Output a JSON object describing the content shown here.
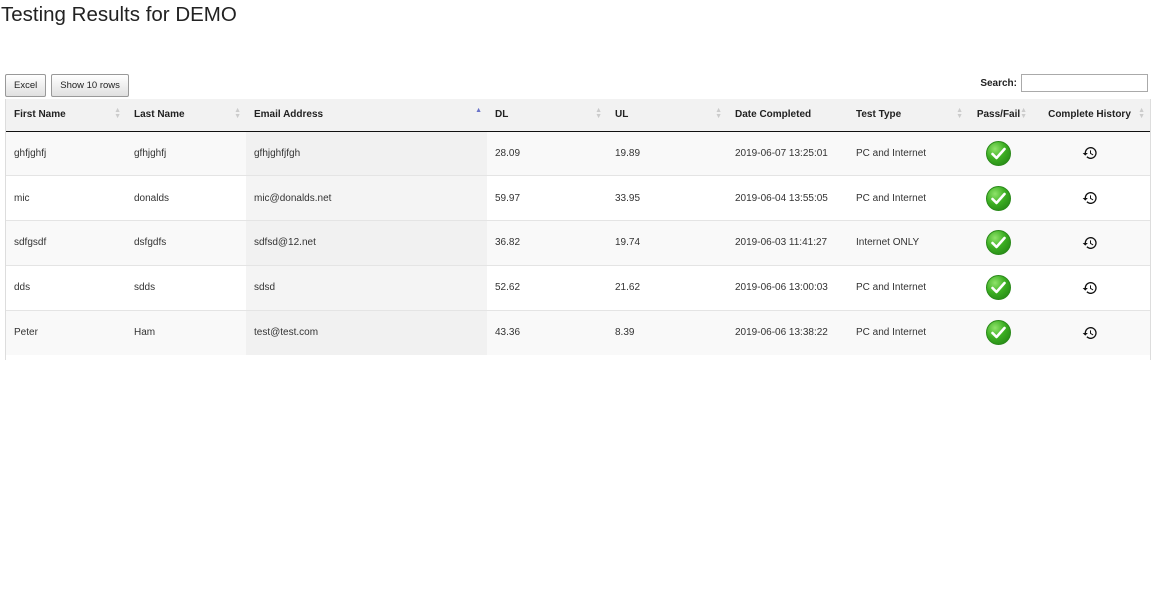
{
  "page": {
    "title": "Testing Results for DEMO"
  },
  "toolbar": {
    "excel_label": "Excel",
    "rows_label": "Show 10 rows"
  },
  "search": {
    "label": "Search:",
    "value": "",
    "placeholder": ""
  },
  "table": {
    "columns": [
      {
        "label": "First Name",
        "sorted": false
      },
      {
        "label": "Last Name",
        "sorted": false
      },
      {
        "label": "Email Address",
        "sorted": "asc"
      },
      {
        "label": "DL",
        "sorted": false
      },
      {
        "label": "UL",
        "sorted": false
      },
      {
        "label": "Date Completed",
        "sorted": false
      },
      {
        "label": "Test Type",
        "sorted": false
      },
      {
        "label": "Pass/Fail",
        "sorted": false
      },
      {
        "label": "Complete History",
        "sorted": false
      }
    ],
    "rows": [
      {
        "first": "ghfjghfj",
        "last": "gfhjghfj",
        "email": "gfhjghfjfgh",
        "dl": "28.09",
        "ul": "19.89",
        "date": "2019-06-07 13:25:01",
        "type": "PC and Internet",
        "status": "pass-icon",
        "history": "history-icon"
      },
      {
        "first": "mic",
        "last": "donalds",
        "email": "mic@donalds.net",
        "dl": "59.97",
        "ul": "33.95",
        "date": "2019-06-04 13:55:05",
        "type": "PC and Internet",
        "status": "pass-icon",
        "history": "history-icon"
      },
      {
        "first": "sdfgsdf",
        "last": "dsfgdfs",
        "email": "sdfsd@12.net",
        "dl": "36.82",
        "ul": "19.74",
        "date": "2019-06-03 11:41:27",
        "type": "Internet ONLY",
        "status": "pass-icon",
        "history": "history-icon"
      },
      {
        "first": "dds",
        "last": "sdds",
        "email": "sdsd",
        "dl": "52.62",
        "ul": "21.62",
        "date": "2019-06-06 13:00:03",
        "type": "PC and Internet",
        "status": "pass-icon",
        "history": "history-icon"
      },
      {
        "first": "Peter",
        "last": "Ham",
        "email": "test@test.com",
        "dl": "43.36",
        "ul": "8.39",
        "date": "2019-06-06 13:38:22",
        "type": "PC and Internet",
        "status": "pass-icon",
        "history": "history-icon"
      }
    ]
  },
  "colors": {
    "sort_active": "#6a73c9",
    "pass_green": "#3cae22",
    "header_bg": "#f2f2f2"
  }
}
